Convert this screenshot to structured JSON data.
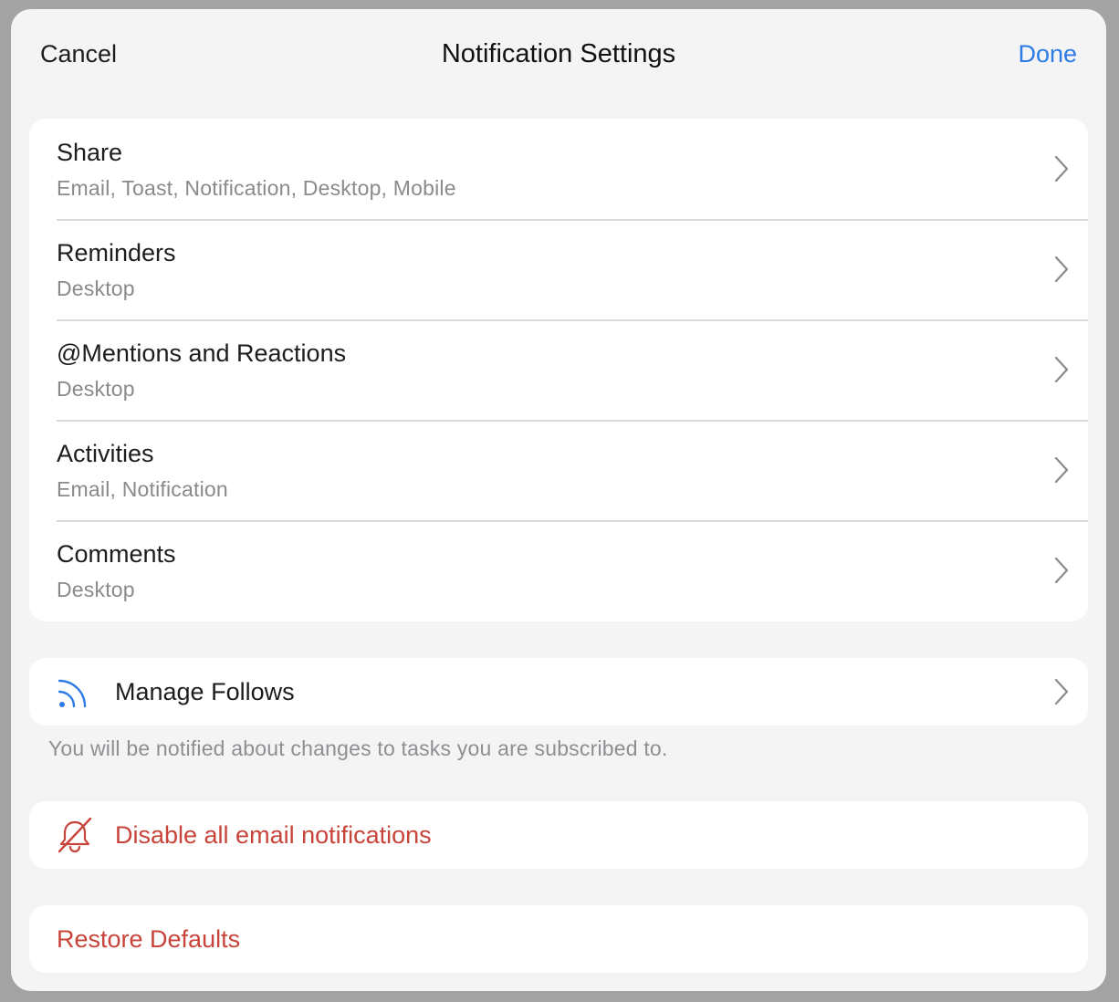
{
  "nav": {
    "cancel_label": "Cancel",
    "title": "Notification Settings",
    "done_label": "Done"
  },
  "settings": [
    {
      "title": "Share",
      "subtitle": "Email, Toast, Notification, Desktop, Mobile"
    },
    {
      "title": "Reminders",
      "subtitle": "Desktop"
    },
    {
      "title": "@Mentions and Reactions",
      "subtitle": "Desktop"
    },
    {
      "title": "Activities",
      "subtitle": "Email, Notification"
    },
    {
      "title": "Comments",
      "subtitle": "Desktop"
    }
  ],
  "follows": {
    "label": "Manage Follows",
    "icon": "rss-feed-icon",
    "footnote": "You will be notified about changes to tasks you are subscribed to."
  },
  "disable_email": {
    "label": "Disable all email notifications",
    "icon": "bell-slash-icon"
  },
  "restore": {
    "label": "Restore Defaults"
  },
  "colors": {
    "accent_blue": "#2d7be5",
    "destructive_red": "#c8443a",
    "background": "#f4f4f4",
    "card": "#ffffff",
    "secondary_text": "#8a8a8e"
  }
}
